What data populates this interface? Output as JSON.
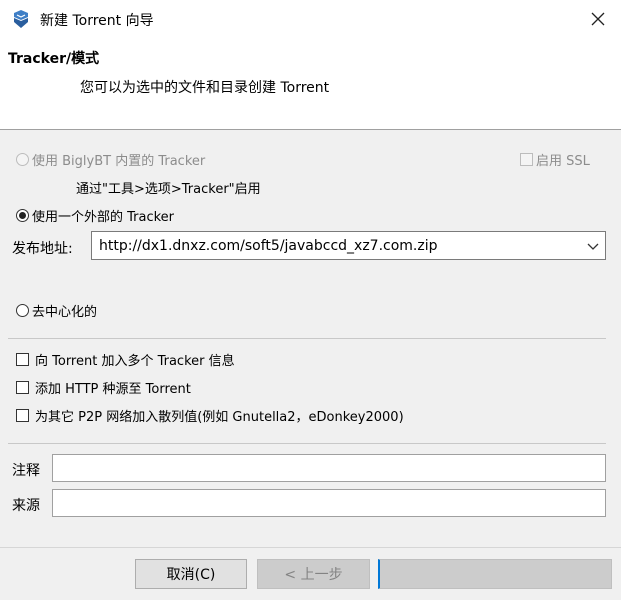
{
  "window": {
    "title": "新建 Torrent 向导"
  },
  "header": {
    "title": "Tracker/模式",
    "description": "您可以为选中的文件和目录创建 Torrent"
  },
  "tracker_options": {
    "internal_label": "使用 BiglyBT 内置的 Tracker",
    "ssl_label": "启用 SSL",
    "internal_hint": "通过\"工具>选项>Tracker\"启用",
    "external_label": "使用一个外部的 Tracker",
    "announce_label": "发布地址:",
    "announce_value": "http://dx1.dnxz.com/soft5/javabccd_xz7.com.zip",
    "decentralized_label": "去中心化的",
    "selected": "external"
  },
  "extra_options": {
    "multi_tracker": "向 Torrent 加入多个 Tracker 信息",
    "http_seeds": "添加 HTTP 种源至 Torrent",
    "p2p_hashes": "为其它 P2P 网络加入散列值(例如 Gnutella2，eDonkey2000)"
  },
  "fields": {
    "comment_label": "注释",
    "comment_value": "",
    "source_label": "来源",
    "source_value": ""
  },
  "buttons": {
    "cancel": "取消(C)",
    "back": "< 上一步",
    "next": ""
  },
  "icons": {
    "app": "biglybt-icon",
    "close": "close-icon",
    "dropdown": "chevron-down-icon"
  }
}
